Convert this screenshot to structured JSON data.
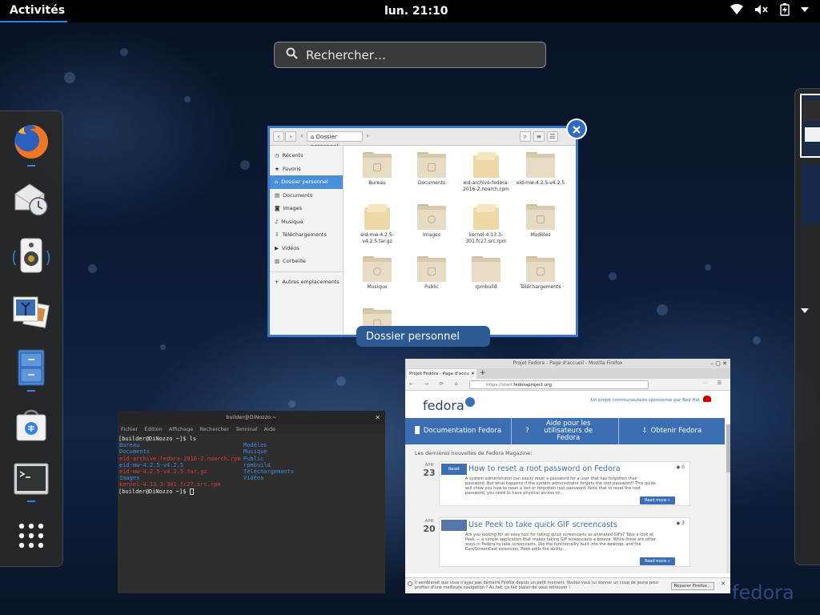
{
  "topbar": {
    "activities": "Activités",
    "clock": "lun. 21:10",
    "icons": [
      "wifi-icon",
      "volume-muted-icon",
      "battery-charging-icon",
      "power-menu-arrow-icon"
    ]
  },
  "search": {
    "placeholder": "Rechercher…"
  },
  "dash": {
    "items": [
      {
        "icon": "firefox-icon",
        "running": true
      },
      {
        "icon": "evolution-mail-clock-icon",
        "running": false
      },
      {
        "icon": "rhythmbox-speaker-icon",
        "running": false
      },
      {
        "icon": "photos-icon",
        "running": false
      },
      {
        "icon": "files-cabinet-icon",
        "running": true
      },
      {
        "icon": "software-bag-icon",
        "running": false
      },
      {
        "icon": "terminal-icon",
        "running": true
      },
      {
        "icon": "show-apps-grid-icon",
        "running": false
      }
    ]
  },
  "nautilus": {
    "label": "Dossier personnel",
    "path_button": "Dossier personnel",
    "sidebar": [
      "Récents",
      "Favoris",
      "Dossier personnel",
      "Documents",
      "Images",
      "Musique",
      "Téléchargements",
      "Vidéos",
      "Corbeille"
    ],
    "sidebar_other": "Autres emplacements",
    "items": [
      {
        "name": "Bureau",
        "type": "folder"
      },
      {
        "name": "Documents",
        "type": "folder"
      },
      {
        "name": "eid-archive-fedora-2016-2.noarch.rpm",
        "type": "package"
      },
      {
        "name": "eid-mw-4.2.5-v4.2.5",
        "type": "folder"
      },
      {
        "name": "eid-mw-4.2.5-v4.2.5.tar.gz",
        "type": "package"
      },
      {
        "name": "Images",
        "type": "folder"
      },
      {
        "name": "kernel-4.13.3-301.fc27.src.rpm",
        "type": "package"
      },
      {
        "name": "Modèles",
        "type": "folder"
      },
      {
        "name": "Musique",
        "type": "folder"
      },
      {
        "name": "Public",
        "type": "folder"
      },
      {
        "name": "rpmbuild",
        "type": "folder"
      },
      {
        "name": "Téléchargements",
        "type": "folder"
      },
      {
        "name": "",
        "type": "folder"
      }
    ]
  },
  "terminal": {
    "title": "builder@DiNozzo:~",
    "menu": [
      "Fichier",
      "Édition",
      "Affichage",
      "Rechercher",
      "Terminal",
      "Aide"
    ],
    "prompt_cmd": "[builder@DiNozzo ~]$ ls",
    "col1": [
      {
        "text": "Bureau",
        "color": "blue"
      },
      {
        "text": "Documents",
        "color": "blue"
      },
      {
        "text": "eid-archive-fedora-2016-2.noarch.rpm",
        "color": "red"
      },
      {
        "text": "eid-mw-4.2.5-v4.2.5",
        "color": "blue"
      },
      {
        "text": "eid-mw-4.2.5-v4.2.5.tar.gz",
        "color": "red"
      },
      {
        "text": "Images",
        "color": "blue"
      },
      {
        "text": "kernel-4.13.3-301.fc27.src.rpm",
        "color": "red"
      }
    ],
    "col2": [
      {
        "text": "Modèles",
        "color": "blue"
      },
      {
        "text": "Musique",
        "color": "blue"
      },
      {
        "text": "Public",
        "color": "blue"
      },
      {
        "text": "rpmbuild",
        "color": "blue"
      },
      {
        "text": "Téléchargements",
        "color": "blue"
      },
      {
        "text": "Vidéos",
        "color": "blue"
      }
    ],
    "prompt_end": "[builder@DiNozzo ~]$ "
  },
  "firefox": {
    "window_title": "Projet Fedora - Page d'accueil - Mozilla Firefox",
    "tab": "Projet Fedora - Page d'accu",
    "url_prefix": "https://start.",
    "url_domain": "fedoraproject.org",
    "logo": "fedora",
    "tagline": "Un projet communautaire sponsorisé par Red Hat",
    "nav": [
      "Documentation Fedora",
      "Aide pour les utilisateurs de Fedora",
      "Obtenir Fedora"
    ],
    "magazine_heading": "Les dernières nouvelles de Fedora Magazine:",
    "posts": [
      {
        "month": "APR",
        "day": "23",
        "title": "How to reset a root password on Fedora",
        "comments": "0",
        "thumb": "Reset",
        "excerpt": "A system administrator can easily reset a password for a user that has forgotten their password. But what happens if the system administrator forgets the root password? This guide will show you how to reset a lost or forgotten root password. Note that to reset the root password, you need to have physical access to…"
      },
      {
        "month": "APR",
        "day": "20",
        "title": "Use Peek to take quick GIF screencasts",
        "comments": "3",
        "thumb": "",
        "excerpt": "Are you looking for an easy tool for taking quick screencasts as animated GIFs? Take a look at Peek — a simple application that makes taking GIF screencasts a breeze. While there are other ways in Fedora to take screencasts, like the functionality built into the desktop, and the EasyScreenCast extension, Peek adds the ability…"
      }
    ],
    "read_more": "Read more »",
    "notification": "Il semblerait que vous n'ayez pas démarré Firefox depuis un petit moment. Voulez-vous lui donner un coup de jeune pour profiter d'une meilleure navigation ? Au fait, ça fait plaisir de vous retrouver !",
    "repair_button": "Réparer Firefox…"
  },
  "wallpaper_text": "fedora",
  "colors": {
    "accent": "#3584e4",
    "fedora_blue": "#3c6eb4",
    "selection": "#4a90d9"
  }
}
